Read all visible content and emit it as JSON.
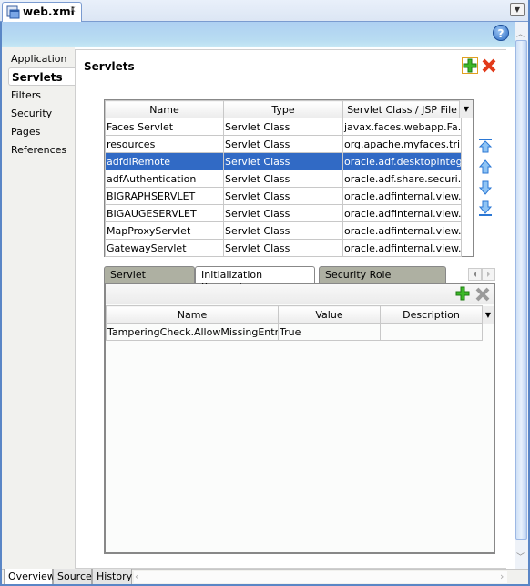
{
  "editor_tab": {
    "title": "web.xml",
    "close": "x"
  },
  "help": "?",
  "sidenav": {
    "items": [
      {
        "label": "Application",
        "selected": false
      },
      {
        "label": "Servlets",
        "selected": true
      },
      {
        "label": "Filters",
        "selected": false
      },
      {
        "label": "Security",
        "selected": false
      },
      {
        "label": "Pages",
        "selected": false
      },
      {
        "label": "References",
        "selected": false
      }
    ]
  },
  "main": {
    "title": "Servlets",
    "servlets": {
      "columns": [
        "Name",
        "Type",
        "Servlet Class / JSP File"
      ],
      "rows": [
        [
          "Faces Servlet",
          "Servlet Class",
          "javax.faces.webapp.Fa..."
        ],
        [
          "resources",
          "Servlet Class",
          "org.apache.myfaces.tri..."
        ],
        [
          "adfdiRemote",
          "Servlet Class",
          "oracle.adf.desktopinteg..."
        ],
        [
          "adfAuthentication",
          "Servlet Class",
          "oracle.adf.share.securi..."
        ],
        [
          "BIGRAPHSERVLET",
          "Servlet Class",
          "oracle.adfinternal.view...."
        ],
        [
          "BIGAUGESERVLET",
          "Servlet Class",
          "oracle.adfinternal.view...."
        ],
        [
          "MapProxyServlet",
          "Servlet Class",
          "oracle.adfinternal.view...."
        ],
        [
          "GatewayServlet",
          "Servlet Class",
          "oracle.adfinternal.view...."
        ]
      ],
      "selected_row": 2
    },
    "tabs": [
      {
        "label": "Servlet Mappings",
        "active": false
      },
      {
        "label": "Initialization Parameters",
        "active": true
      },
      {
        "label": "Security Role References",
        "active": false
      }
    ],
    "params": {
      "columns": [
        "Name",
        "Value",
        "Description"
      ],
      "rows": [
        [
          "TamperingCheck.AllowMissingEntries",
          "True",
          ""
        ]
      ]
    }
  },
  "bottom_tabs": [
    {
      "label": "Overview",
      "active": true
    },
    {
      "label": "Source",
      "active": false
    },
    {
      "label": "History",
      "active": false
    }
  ],
  "colors": {
    "selection": "#316ac5",
    "frame": "#5a86c6"
  }
}
